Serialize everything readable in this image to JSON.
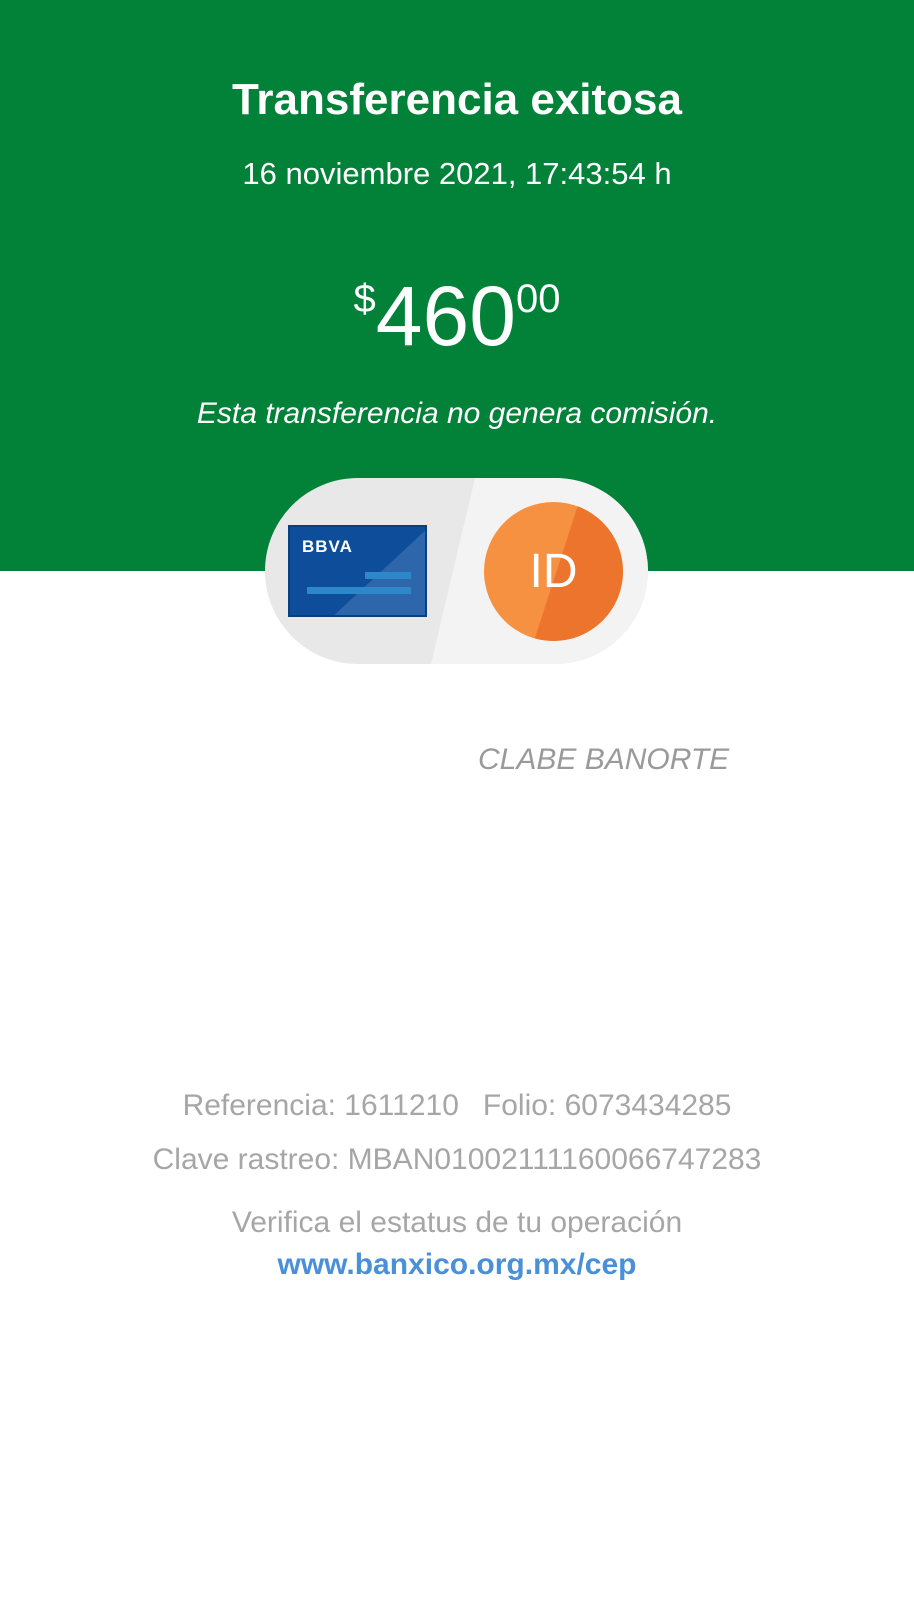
{
  "header": {
    "title": "Transferencia exitosa",
    "datetime": "16 noviembre 2021, 17:43:54 h",
    "amount": {
      "currency": "$",
      "integer": "460",
      "decimals": "00"
    },
    "note": "Esta transferencia no genera comisión.",
    "background_color": "#028139"
  },
  "transfer": {
    "origin_card": {
      "brand": "BBVA",
      "icon": "bank-card-icon",
      "color": "#0d4d99"
    },
    "destination_avatar": {
      "initials": "ID",
      "color": "#f59140"
    },
    "destination_label": "CLABE BANORTE"
  },
  "details": {
    "referencia": "Referencia: 1611210",
    "folio": "Folio: 6073434285",
    "clave_rastreo": "Clave rastreo: MBAN01002111160066747283"
  },
  "verify": {
    "text": "Verifica el estatus de tu operación",
    "link": "www.banxico.org.mx/cep",
    "link_color": "#4a90d9"
  }
}
